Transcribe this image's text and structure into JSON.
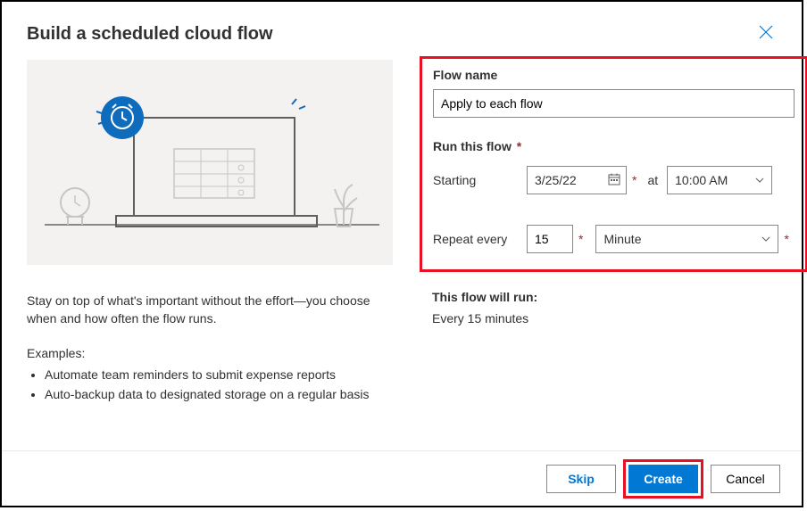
{
  "dialog": {
    "title": "Build a scheduled cloud flow"
  },
  "left": {
    "description": "Stay on top of what's important without the effort—you choose when and how often the flow runs.",
    "examples_label": "Examples:",
    "examples": [
      "Automate team reminders to submit expense reports",
      "Auto-backup data to designated storage on a regular basis"
    ]
  },
  "form": {
    "flow_name_label": "Flow name",
    "flow_name_value": "Apply to each flow",
    "run_section_label": "Run this flow",
    "starting_label": "Starting",
    "starting_date": "3/25/22",
    "at_label": "at",
    "starting_time": "10:00 AM",
    "repeat_label": "Repeat every",
    "repeat_value": "15",
    "repeat_unit": "Minute"
  },
  "summary": {
    "label": "This flow will run:",
    "text": "Every 15 minutes"
  },
  "footer": {
    "skip": "Skip",
    "create": "Create",
    "cancel": "Cancel"
  }
}
